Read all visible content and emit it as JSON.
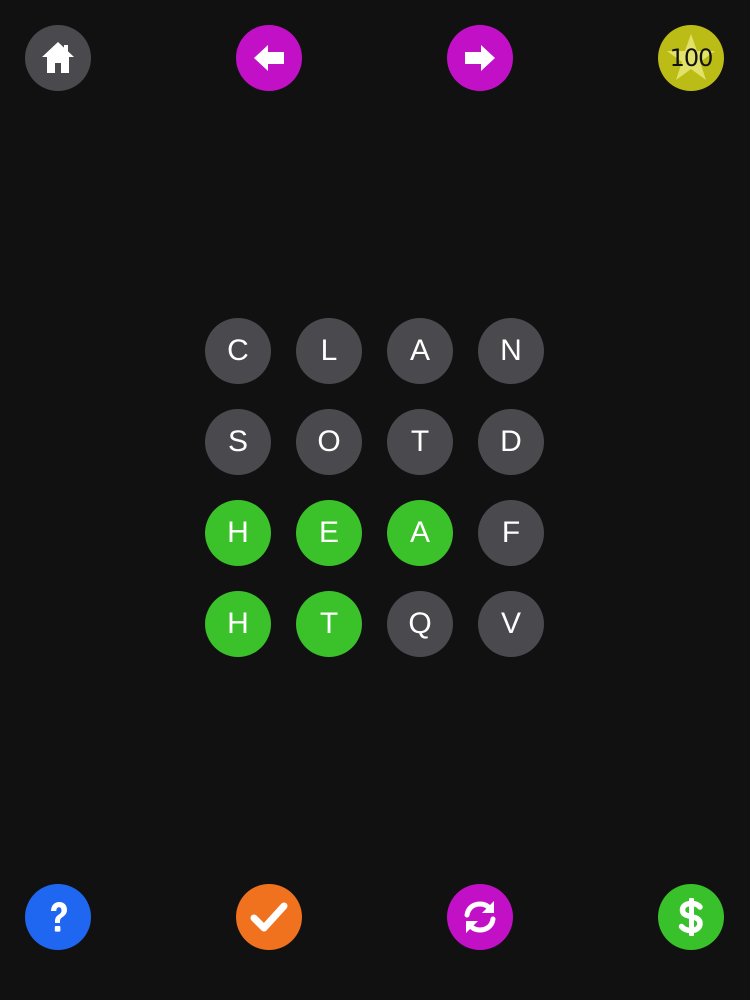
{
  "header": {
    "score": "100"
  },
  "grid": [
    {
      "letter": "C",
      "selected": false
    },
    {
      "letter": "L",
      "selected": false
    },
    {
      "letter": "A",
      "selected": false
    },
    {
      "letter": "N",
      "selected": false
    },
    {
      "letter": "S",
      "selected": false
    },
    {
      "letter": "O",
      "selected": false
    },
    {
      "letter": "T",
      "selected": false
    },
    {
      "letter": "D",
      "selected": false
    },
    {
      "letter": "H",
      "selected": true
    },
    {
      "letter": "E",
      "selected": true
    },
    {
      "letter": "A",
      "selected": true
    },
    {
      "letter": "F",
      "selected": false
    },
    {
      "letter": "H",
      "selected": true
    },
    {
      "letter": "T",
      "selected": true
    },
    {
      "letter": "Q",
      "selected": false
    },
    {
      "letter": "V",
      "selected": false
    }
  ],
  "colors": {
    "background": "#111112",
    "tile": "#4a494d",
    "tile_selected": "#3bc12a",
    "nav_arrows": "#c210c7",
    "score_badge": "#bcbc16",
    "help": "#1f67f0",
    "check": "#f0721e",
    "refresh": "#c210c7",
    "coins": "#38c12a"
  },
  "icons": {
    "home": "home-icon",
    "prev": "arrow-left-icon",
    "next": "arrow-right-icon",
    "score": "star-icon",
    "help": "question-icon",
    "check": "checkmark-icon",
    "refresh": "refresh-icon",
    "coins": "dollar-icon"
  }
}
